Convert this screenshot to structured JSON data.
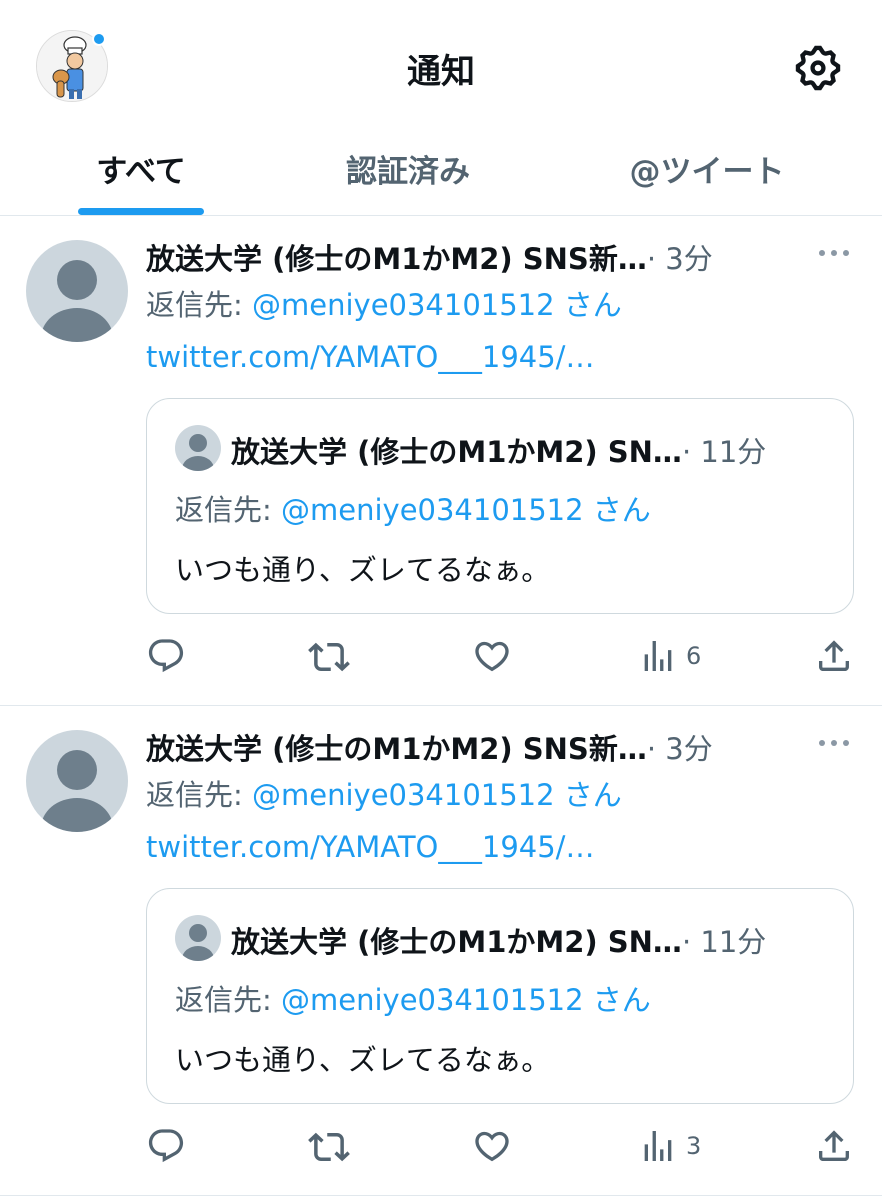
{
  "header": {
    "title": "通知",
    "avatar_icon": "profile-avatar-chef",
    "notification_dot_color": "#1d9bf0",
    "settings_icon": "gear-icon"
  },
  "tabs": [
    {
      "label": "すべて",
      "active": true
    },
    {
      "label": "認証済み",
      "active": false
    },
    {
      "label": "@ツイート",
      "active": false
    }
  ],
  "tweets": [
    {
      "author": "放送大学 (修士のM1かM2) SNS新…",
      "time": "· 3分",
      "reply_prefix": "返信先: ",
      "reply_handle": "@meniye034101512",
      "reply_suffix": " さん",
      "link": "twitter.com/YAMATO___1945/…",
      "quote": {
        "author": "放送大学 (修士のM1かM2) SN…",
        "time": "· 11分",
        "reply_prefix": "返信先: ",
        "reply_handle": "@meniye034101512",
        "reply_suffix": " さん",
        "text": "いつも通り、ズレてるなぁ。"
      },
      "views": "6"
    },
    {
      "author": "放送大学 (修士のM1かM2) SNS新…",
      "time": "· 3分",
      "reply_prefix": "返信先: ",
      "reply_handle": "@meniye034101512",
      "reply_suffix": " さん",
      "link": "twitter.com/YAMATO___1945/…",
      "quote": {
        "author": "放送大学 (修士のM1かM2) SN…",
        "time": "· 11分",
        "reply_prefix": "返信先: ",
        "reply_handle": "@meniye034101512",
        "reply_suffix": " さん",
        "text": "いつも通り、ズレてるなぁ。"
      },
      "views": "3"
    }
  ],
  "colors": {
    "accent": "#1d9bf0",
    "secondary_text": "#536471",
    "border": "#cfd9de"
  }
}
